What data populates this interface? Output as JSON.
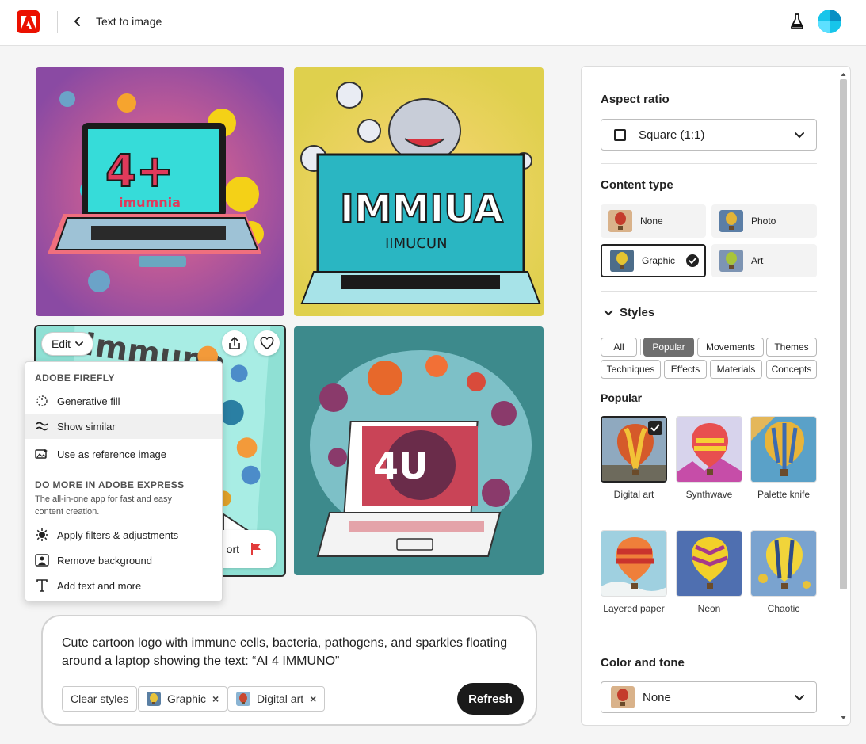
{
  "header": {
    "title": "Text to image"
  },
  "colors": {
    "brand": "#eb1000",
    "selected_tag": "#6e6e6e",
    "refresh_bg": "#1a1a1a"
  },
  "gallery": {
    "tiles": [
      {
        "label_art": "4+",
        "sub_art": "imumnia"
      },
      {
        "label_art": "IMMIUA",
        "sub_art": "IIMUCUN"
      },
      {
        "label_art": "Immune"
      },
      {
        "label_art": "4U"
      }
    ],
    "edit_label": "Edit",
    "report_label": "ort"
  },
  "menu": {
    "section1_title": "ADOBE FIREFLY",
    "items1": [
      {
        "label": "Generative fill",
        "icon": "generative-fill-icon"
      },
      {
        "label": "Show similar",
        "icon": "show-similar-icon"
      },
      {
        "label": "Use as reference image",
        "icon": "reference-image-icon"
      }
    ],
    "section2_title": "DO MORE IN ADOBE EXPRESS",
    "section2_desc": "The all-in-one app for fast and easy content creation.",
    "items2": [
      {
        "label": "Apply filters & adjustments",
        "icon": "adjustments-icon"
      },
      {
        "label": "Remove background",
        "icon": "remove-background-icon"
      },
      {
        "label": "Add text and more",
        "icon": "text-icon"
      }
    ]
  },
  "prompt": {
    "text": "Cute cartoon logo with immune cells, bacteria, pathogens, and sparkles floating around a laptop showing the text: “AI 4 IMMUNO”",
    "clear_label": "Clear styles",
    "chips": [
      "Graphic",
      "Digital art"
    ],
    "refresh_label": "Refresh"
  },
  "panel": {
    "aspect_title": "Aspect ratio",
    "aspect_value": "Square (1:1)",
    "content_title": "Content type",
    "content_types": [
      "None",
      "Photo",
      "Graphic",
      "Art"
    ],
    "content_selected": "Graphic",
    "styles_title": "Styles",
    "style_tags": [
      "All",
      "Popular",
      "Movements",
      "Themes",
      "Techniques",
      "Effects",
      "Materials",
      "Concepts"
    ],
    "style_tag_selected": "Popular",
    "popular_title": "Popular",
    "styles": [
      "Digital art",
      "Synthwave",
      "Palette knife",
      "Layered paper",
      "Neon",
      "Chaotic"
    ],
    "style_selected": "Digital art",
    "color_title": "Color and tone",
    "color_value": "None"
  }
}
